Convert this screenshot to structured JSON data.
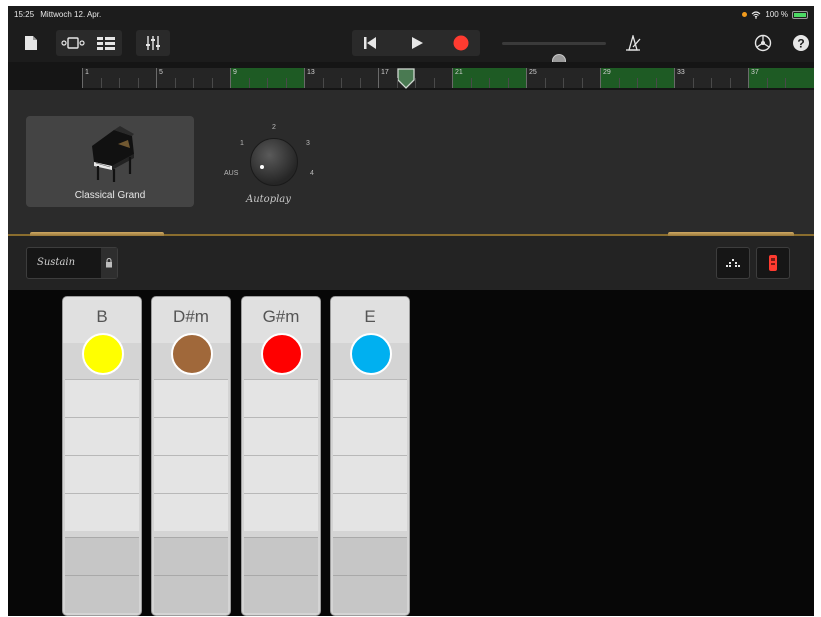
{
  "status_bar": {
    "time": "15:25",
    "date": "Mittwoch 12. Apr.",
    "battery": "100 %"
  },
  "toolbar": {
    "icons": [
      "document-icon",
      "view-toggle-icon",
      "tracks-icon",
      "mixer-icon",
      "rewind-icon",
      "play-icon",
      "record-icon",
      "metronome-icon",
      "settings-icon",
      "help-icon"
    ],
    "master_volume": 0.55,
    "record_color": "#ff3b30"
  },
  "ruler": {
    "bar_labels": [
      "1",
      "5",
      "9",
      "13",
      "17",
      "21",
      "25",
      "29",
      "33",
      "37"
    ],
    "add_label": "+"
  },
  "instrument": {
    "name": "Classical Grand",
    "autoplay_label": "Autoplay",
    "autoplay_positions": [
      "AUS",
      "1",
      "2",
      "3",
      "4"
    ]
  },
  "controls": {
    "sustain_label": "Sustain"
  },
  "chord_strips": [
    {
      "chord": "B",
      "color": "#ffff00"
    },
    {
      "chord": "D#m",
      "color": "#a0683a"
    },
    {
      "chord": "G#m",
      "color": "#ff0000"
    },
    {
      "chord": "E",
      "color": "#00b0f0"
    }
  ]
}
